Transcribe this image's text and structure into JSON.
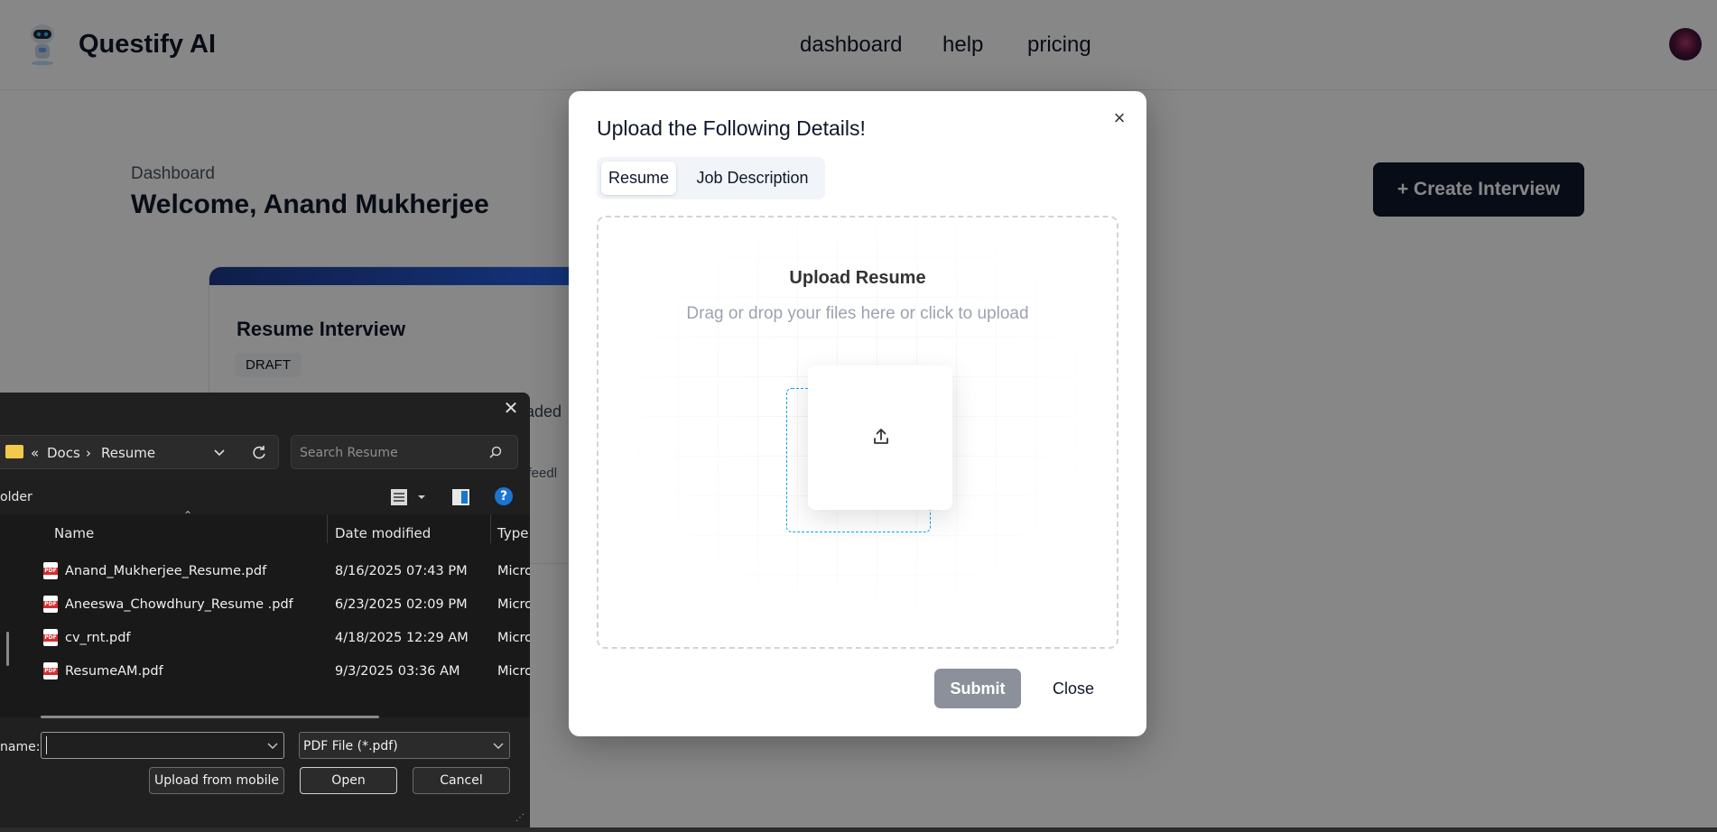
{
  "app": {
    "brand": "Questify AI",
    "nav": {
      "dashboard": "dashboard",
      "help": "help",
      "pricing": "pricing"
    },
    "breadcrumb": "Dashboard",
    "welcome": "Welcome, Anand Mukherjee",
    "create_button": "+ Create Interview",
    "card": {
      "title": "Resume Interview",
      "badge": "DRAFT",
      "snippet1": "oaded",
      "snippet2": "o feedl"
    }
  },
  "modal": {
    "title": "Upload the Following Details!",
    "close_icon": "×",
    "tabs": [
      {
        "label": "Resume",
        "active": true
      },
      {
        "label": "Job Description",
        "active": false
      }
    ],
    "dropzone": {
      "title": "Upload Resume",
      "subtitle": "Drag or drop your files here or click to upload",
      "icon": "upload-icon"
    },
    "submit_label": "Submit",
    "close_label": "Close"
  },
  "file_dialog": {
    "close_icon": "✕",
    "address": [
      "«",
      "Docs",
      "›",
      "Resume"
    ],
    "search_placeholder": "Search Resume",
    "toolbar_label": "older",
    "help_label": "?",
    "columns": [
      "Name",
      "Date modified",
      "Type"
    ],
    "files": [
      {
        "name": "Anand_Mukherjee_Resume.pdf",
        "date": "8/16/2025 07:43 PM",
        "type": "Micro"
      },
      {
        "name": "Aneeswa_Chowdhury_Resume .pdf",
        "date": "6/23/2025 02:09 PM",
        "type": "Micro"
      },
      {
        "name": "cv_rnt.pdf",
        "date": "4/18/2025 12:29 AM",
        "type": "Micro"
      },
      {
        "name": "ResumeAM.pdf",
        "date": "9/3/2025 03:36 AM",
        "type": "Micro"
      }
    ],
    "filename_label": "name:",
    "filename_value": "",
    "filetype": "PDF File (*.pdf)",
    "buttons": {
      "mobile": "Upload from mobile",
      "open": "Open",
      "cancel": "Cancel"
    }
  }
}
